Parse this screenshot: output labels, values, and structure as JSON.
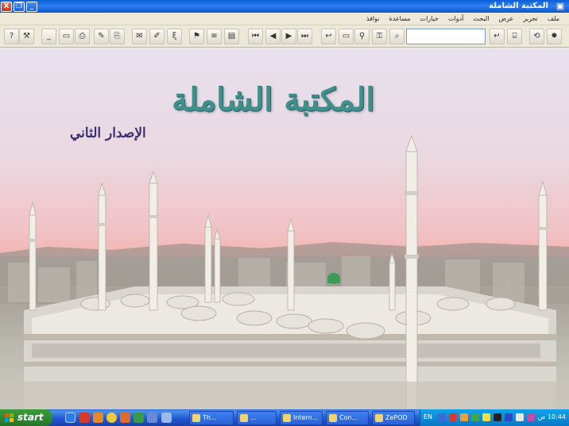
{
  "window": {
    "title": "المكتبة الشاملة",
    "controls": {
      "close": "X",
      "restore": "❐",
      "minimize": "_"
    }
  },
  "menu": {
    "items": [
      "ملف",
      "تحرير",
      "عرض",
      "البحث",
      "أدوات",
      "خيارات",
      "مساعدة",
      "نوافذ"
    ]
  },
  "toolbar": {
    "search_value": "",
    "buttons": [
      {
        "name": "help-button",
        "glyph": "?"
      },
      {
        "name": "tools-button",
        "glyph": "⚒"
      },
      {
        "name": "minimize-pane-button",
        "glyph": "_"
      },
      {
        "name": "window-button",
        "glyph": "▭"
      },
      {
        "name": "print-button",
        "glyph": "⎙"
      },
      {
        "name": "edit-button",
        "glyph": "✎"
      },
      {
        "name": "copy-button",
        "glyph": "⎘"
      },
      {
        "name": "mail-button",
        "glyph": "✉"
      },
      {
        "name": "pen-button",
        "glyph": "✐"
      },
      {
        "name": "format-button",
        "glyph": "ξ"
      },
      {
        "name": "bookmark-button",
        "glyph": "⚑"
      },
      {
        "name": "list-button",
        "glyph": "≡"
      },
      {
        "name": "book-button",
        "glyph": "▤"
      },
      {
        "name": "first-page-button",
        "glyph": "⏮"
      },
      {
        "name": "prev-page-button",
        "glyph": "◀"
      },
      {
        "name": "next-page-button",
        "glyph": "▶"
      },
      {
        "name": "last-page-button",
        "glyph": "⏭"
      },
      {
        "name": "back-button",
        "glyph": "↩"
      },
      {
        "name": "open-folder-button",
        "glyph": "▭"
      },
      {
        "name": "find-button",
        "glyph": "⚲"
      },
      {
        "name": "lock-button",
        "glyph": "⚿"
      },
      {
        "name": "search-web-button",
        "glyph": "⌕"
      },
      {
        "name": "go-button",
        "glyph": "↵"
      },
      {
        "name": "index-button",
        "glyph": "⌸"
      },
      {
        "name": "refresh-button",
        "glyph": "⟲"
      },
      {
        "name": "settings-button",
        "glyph": "✸"
      }
    ]
  },
  "splash": {
    "title": "المكتبة الشاملة",
    "subtitle": "الإصدار الثاني"
  },
  "taskbar": {
    "start_label": "start",
    "tasks": [
      "Th...",
      "...",
      "Intern...",
      "Con...",
      "ZePOD"
    ],
    "tray_lang": "EN",
    "clock": "10:44 ص"
  },
  "colors": {
    "titlebar": "#0a5fd6",
    "taskbar": "#2157d7",
    "start": "#2f8a2f",
    "splash_title": "#3f8f8a",
    "splash_subtitle": "#3c2f70"
  }
}
